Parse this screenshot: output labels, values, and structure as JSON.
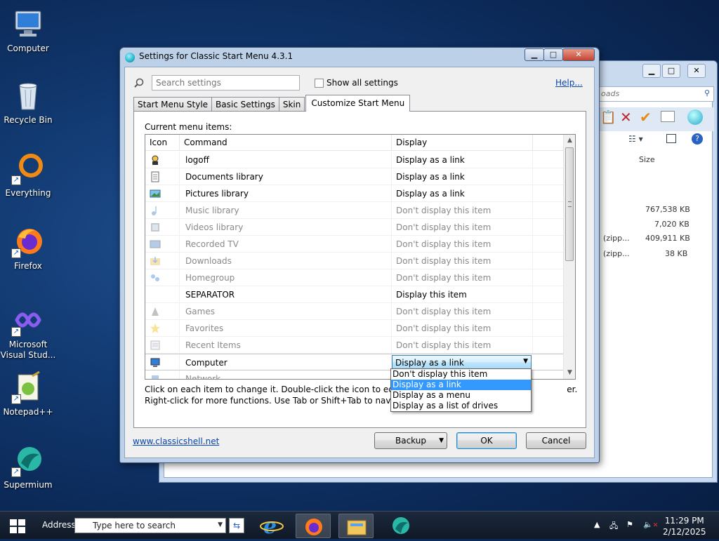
{
  "desktop": {
    "icons": [
      {
        "label": "Computer",
        "icon": "computer-icon"
      },
      {
        "label": "Recycle Bin",
        "icon": "recycle-bin-icon"
      },
      {
        "label": "Everything",
        "icon": "everything-icon"
      },
      {
        "label": "Firefox",
        "icon": "firefox-icon"
      },
      {
        "label": "Microsoft Visual Stud...",
        "icon": "visual-studio-icon"
      },
      {
        "label": "Notepad++",
        "icon": "notepad-plus-plus-icon"
      },
      {
        "label": "Supermium",
        "icon": "supermium-icon"
      }
    ]
  },
  "background_window": {
    "search_placeholder": "oads",
    "column_size": "Size",
    "rows": [
      {
        "type": "",
        "size": "767,538 KB"
      },
      {
        "type": "",
        "size": "7,020 KB"
      },
      {
        "type": "(zipp...",
        "size": "409,911 KB"
      },
      {
        "type": "(zipp...",
        "size": "38 KB"
      }
    ]
  },
  "dialog": {
    "title": "Settings for Classic Start Menu 4.3.1",
    "caption_buttons": {
      "minimize": "▁",
      "maximize": "□",
      "close": "✕"
    },
    "search": {
      "placeholder": "Search settings"
    },
    "show_all_label": "Show all settings",
    "help_label": "Help...",
    "tabs": [
      "Start Menu Style",
      "Basic Settings",
      "Skin",
      "Customize Start Menu"
    ],
    "current_items_label": "Current menu items:",
    "columns": {
      "icon": "Icon",
      "command": "Command",
      "display": "Display"
    },
    "items": [
      {
        "command": "logoff",
        "display": "Display as a link",
        "dim": false
      },
      {
        "command": "Documents library",
        "display": "Display as a link",
        "dim": false
      },
      {
        "command": "Pictures library",
        "display": "Display as a link",
        "dim": false
      },
      {
        "command": "Music library",
        "display": "Don't display this item",
        "dim": true
      },
      {
        "command": "Videos library",
        "display": "Don't display this item",
        "dim": true
      },
      {
        "command": "Recorded TV",
        "display": "Don't display this item",
        "dim": true
      },
      {
        "command": "Downloads",
        "display": "Don't display this item",
        "dim": true
      },
      {
        "command": "Homegroup",
        "display": "Don't display this item",
        "dim": true
      },
      {
        "command": "SEPARATOR",
        "display": "Display this item",
        "dim": false
      },
      {
        "command": "Games",
        "display": "Don't display this item",
        "dim": true
      },
      {
        "command": "Favorites",
        "display": "Don't display this item",
        "dim": true
      },
      {
        "command": "Recent Items",
        "display": "Don't display this item",
        "dim": true
      },
      {
        "command": "Computer",
        "display": "Display as a link",
        "dim": false
      },
      {
        "command": "Network",
        "display": "",
        "dim": true
      }
    ],
    "selected_combo_value": "Display as a link",
    "dropdown_options": [
      "Don't display this item",
      "Display as a link",
      "Display as a menu",
      "Display as a list of drives"
    ],
    "dropdown_highlighted_index": 1,
    "hint_line1": "Click on each item to change it. Double-click the icon to edit the ad",
    "hint_line1_tail": "er.",
    "hint_line2": "Right-click for more functions. Use Tab or Shift+Tab to navigate wi",
    "website_link": "www.classicshell.net",
    "buttons": {
      "backup": "Backup",
      "ok": "OK",
      "cancel": "Cancel"
    }
  },
  "taskbar": {
    "address_label": "Address",
    "search_text": "Type here to search",
    "apps": [
      "internet-explorer-icon",
      "firefox-icon",
      "file-explorer-icon",
      "supermium-icon"
    ],
    "clock_time": "11:29 PM",
    "clock_date": "2/12/2025"
  },
  "colors": {
    "highlight": "#3399ff",
    "link": "#0645ad",
    "desktop_bg": "#123a72"
  }
}
